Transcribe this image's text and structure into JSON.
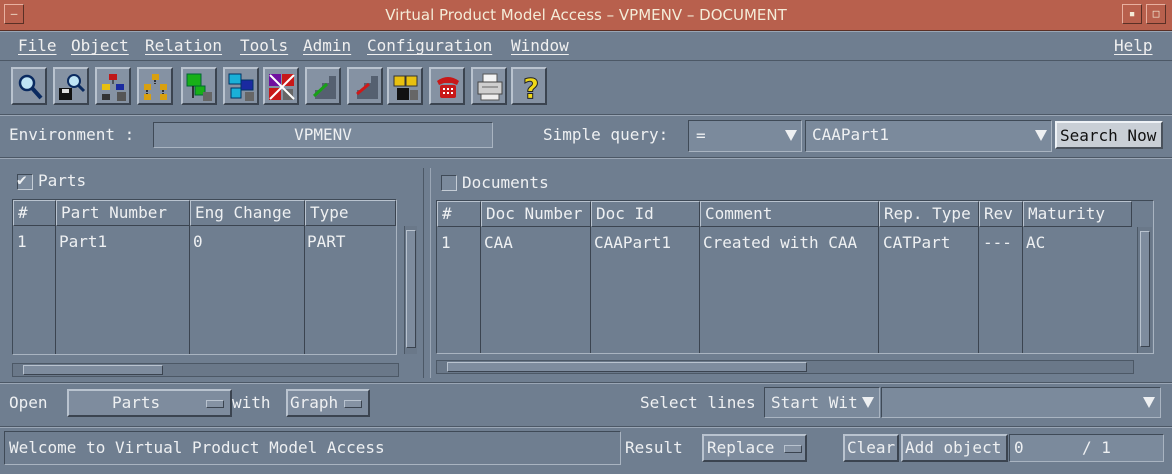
{
  "window": {
    "title": "Virtual Product Model Access – VPMENV – DOCUMENT"
  },
  "menu": {
    "items": [
      "File",
      "Object",
      "Relation",
      "Tools",
      "Admin",
      "Configuration",
      "Window"
    ],
    "help": "Help"
  },
  "toolbar": {
    "icons": [
      "search-icon",
      "search-save-icon",
      "tree-list-icon",
      "tree-icon",
      "green-tree-icon",
      "tree-copy-icon",
      "delete-relation-icon",
      "stairs-icon",
      "stairs-edit-icon",
      "folder-link-icon",
      "phone-icon",
      "printer-icon",
      "help-icon"
    ]
  },
  "environment": {
    "label": "Environment :",
    "value": "VPMENV"
  },
  "query": {
    "label": "Simple query:",
    "operator": "=",
    "value": "CAAPart1",
    "button": "Search Now"
  },
  "parts": {
    "label": "Parts",
    "checked": true,
    "columns": [
      "#",
      "Part Number",
      "Eng Change",
      "Type"
    ],
    "rows": [
      [
        "1",
        "Part1",
        "0",
        "PART"
      ]
    ]
  },
  "documents": {
    "label": "Documents",
    "checked": false,
    "columns": [
      "#",
      "Doc Number",
      "Doc Id",
      "Comment",
      "Rep. Type",
      "Rev",
      "Maturity"
    ],
    "rows": [
      [
        "1",
        "CAA",
        "CAAPart1",
        "Created with CAA",
        "CATPart",
        "---",
        "AC"
      ]
    ]
  },
  "open_row": {
    "open_label": "Open",
    "open_value": "Parts",
    "with_label": "with",
    "with_value": "Graph",
    "select_label": "Select lines",
    "select_value": "Start Wit",
    "select_text": ""
  },
  "status_bar": {
    "message": "Welcome to Virtual Product Model Access",
    "result_label": "Result",
    "result_value": "Replace",
    "clear_button": "Clear",
    "add_button": "Add object",
    "counter_value": "0",
    "counter_total": "/ 1"
  },
  "colors": {
    "titlebar": "#b8604d",
    "panel": "#6f7e90"
  }
}
